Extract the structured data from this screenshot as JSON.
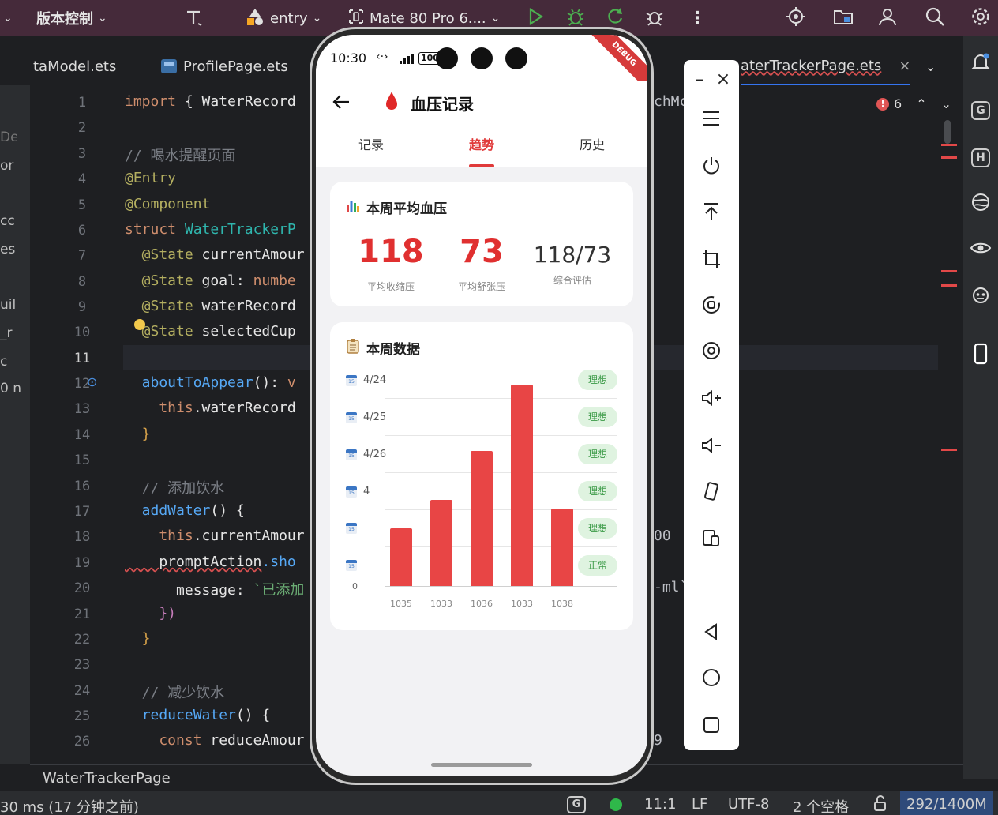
{
  "toolbar": {
    "vcs_label": "版本控制",
    "module_label": "entry",
    "device_label": "Mate 80 Pro 6...."
  },
  "tabs": {
    "left_file": "taModel.ets",
    "profile_file": "ProfilePage.ets",
    "right_file": "aterTrackerPage.ets"
  },
  "left_panel": [
    "De",
    "or",
    "cc",
    "es",
    "uilc",
    "_r",
    "c",
    "0 n"
  ],
  "editor": {
    "line_numbers": [
      "1",
      "2",
      "3",
      "4",
      "5",
      "6",
      "7",
      "8",
      "9",
      "10",
      "11",
      "12",
      "13",
      "14",
      "15",
      "16",
      "17",
      "18",
      "19",
      "20",
      "21",
      "22",
      "23",
      "24",
      "25",
      "26"
    ],
    "lines": {
      "l1a": "import",
      "l1b": " { ",
      "l1c": "WaterRecord",
      "l3": "// 喝水提醒页面",
      "l4": "@Entry",
      "l5": "@Component",
      "l6a": "struct",
      "l6b": " WaterTrackerP",
      "l7a": "  @State",
      "l7b": " currentAmour",
      "l8a": "  @State",
      "l8b": " goal: ",
      "l8c": "numbe",
      "l9a": "  @State",
      "l9b": " waterRecord",
      "l10a": "  @State",
      "l10b": " selectedCup",
      "l12a": "  aboutToAppear",
      "l12b": "(): ",
      "l12c": "v",
      "l13a": "    this",
      "l13b": ".waterRecord",
      "l14": "  }",
      "l16": "  // 添加饮水",
      "l17a": "  addWater",
      "l17b": "() {",
      "l18a": "    this",
      "l18b": ".currentAmour",
      "l19a": "    promptAction",
      "l19b": ".sho",
      "l20a": "      message: ",
      "l20b": "`已添加",
      "l21": "    })",
      "l22": "  }",
      "l24": "  // 减少饮水",
      "l25a": "  reduceWater",
      "l25b": "() {",
      "l26a": "    const",
      "l26b": " reduceAmour"
    },
    "right_fragments": {
      "r1": "chMc",
      "r2": "00",
      "r3": "-ml`",
      "r4": "9"
    },
    "error_count": "6"
  },
  "breadcrumb": "WaterTrackerPage",
  "status": {
    "left": "30 ms (17 分钟之前)",
    "position": "11:1",
    "line_sep": "LF",
    "encoding": "UTF-8",
    "indent": "2 个空格",
    "memory": "292/1400M"
  },
  "phone": {
    "time": "10:30",
    "battery": "100",
    "debug_label": "DEBUG",
    "title": "血压记录",
    "tabs": [
      "记录",
      "趋势",
      "历史"
    ],
    "active_tab": 1,
    "avg_card": {
      "title": "本周平均血压",
      "systolic": "118",
      "systolic_label": "平均收缩压",
      "diastolic": "73",
      "diastolic_label": "平均舒张压",
      "combined": "118/73",
      "combined_label": "综合评估"
    },
    "week_card": {
      "title": "本周数据",
      "rows": [
        {
          "date": "4/24",
          "badge": "理想"
        },
        {
          "date": "4/25",
          "badge": "理想"
        },
        {
          "date": "4/26",
          "badge": "理想"
        },
        {
          "date": "4",
          "badge": "理想"
        },
        {
          "date": "",
          "badge": "理想"
        },
        {
          "date": "",
          "badge": "正常"
        }
      ],
      "zero_label": "0"
    }
  },
  "chart_data": {
    "type": "bar",
    "categories": [
      "1035",
      "1033",
      "1036",
      "1033",
      "1038"
    ],
    "values": [
      20,
      30,
      47,
      70,
      27
    ],
    "ylim": [
      0,
      72
    ],
    "title": "",
    "xlabel": "",
    "ylabel": "",
    "colors": {
      "bar": "#e84545"
    }
  },
  "colors": {
    "accent": "#e03a3a",
    "toolbar_bg": "#452a3a",
    "badge_bg": "#dff3e0",
    "badge_fg": "#3a9a46"
  }
}
